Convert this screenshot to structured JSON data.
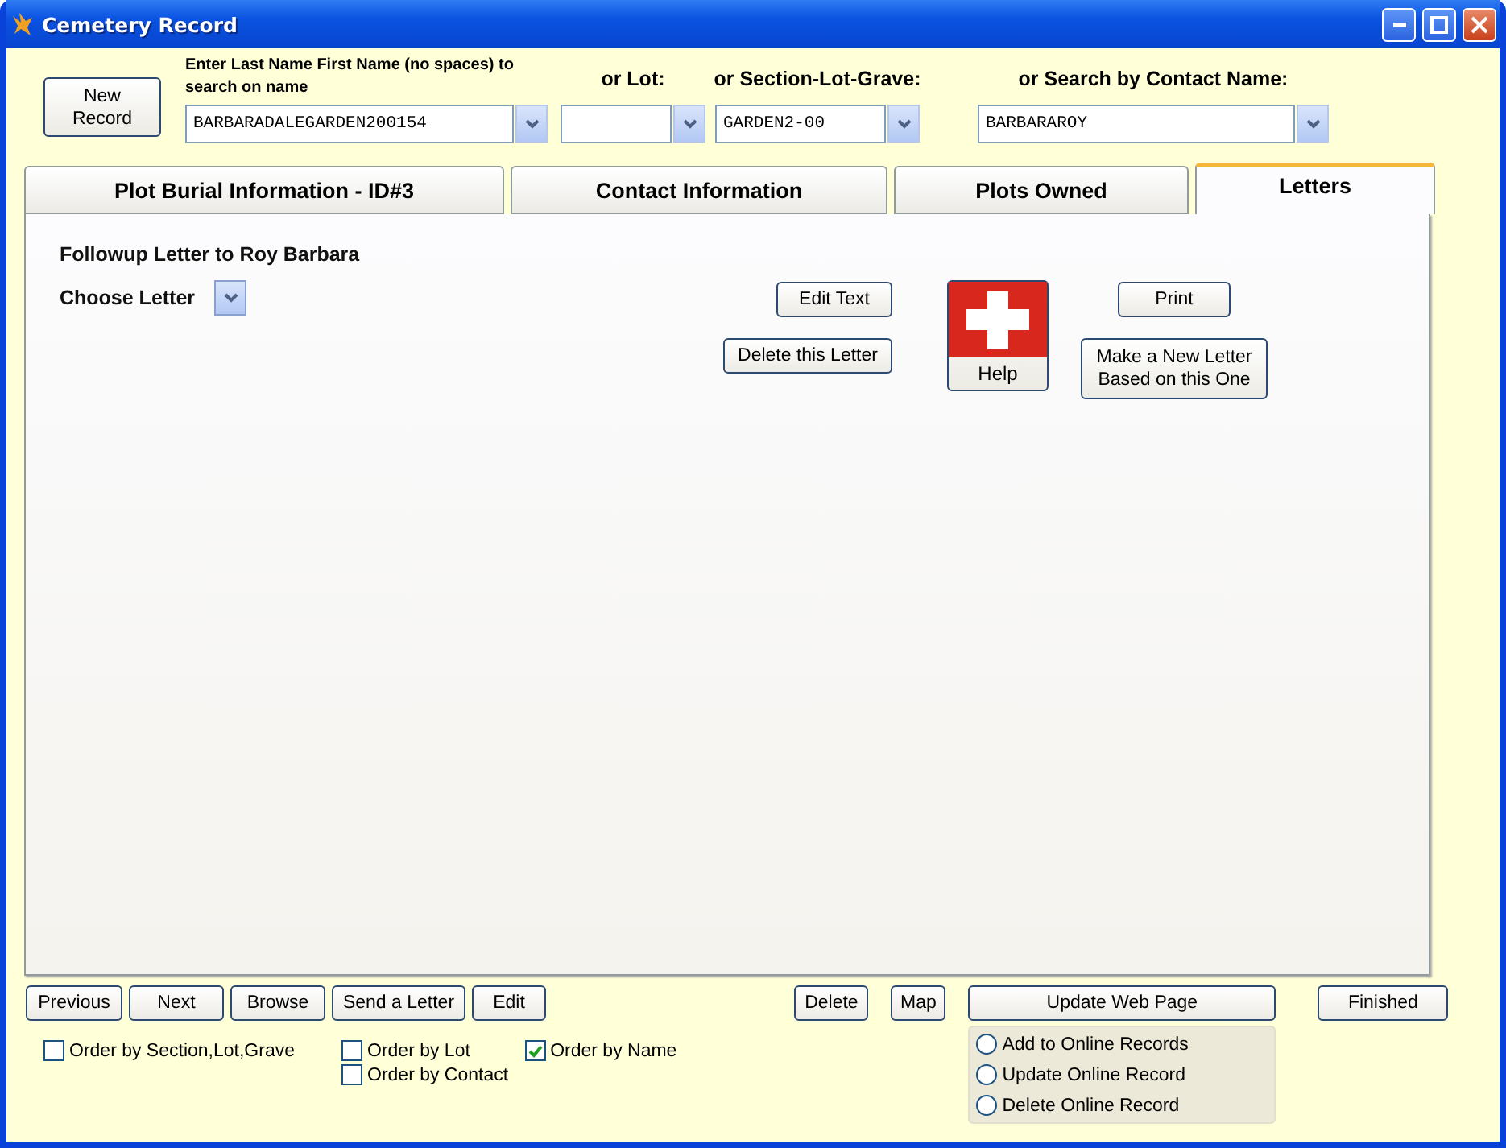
{
  "window": {
    "title": "Cemetery Record"
  },
  "new_record_button": "New\nRecord",
  "search_fields": [
    {
      "label": "Enter Last Name First Name (no spaces) to search on name",
      "value": "BARBARADALEGARDEN200154",
      "kind": "small"
    },
    {
      "label": "or Lot:",
      "kind": "large"
    },
    {
      "label": "or Section-Lot-Grave:",
      "value": "GARDEN2-00",
      "kind": "large"
    },
    {
      "label": "or Search by Contact Name:",
      "value": "BARBARAROY",
      "kind": "large"
    }
  ],
  "tabs": [
    {
      "label": "Plot Burial Information - ID#3",
      "selected": false
    },
    {
      "label": "Contact Information",
      "selected": false
    },
    {
      "label": "Plots Owned",
      "selected": false
    },
    {
      "label": "Letters",
      "selected": true
    }
  ],
  "letters": {
    "heading": "Followup Letter to Roy Barbara",
    "choose_label": "Choose Letter",
    "edit_text_button": "Edit Text",
    "delete_button": "Delete this Letter",
    "help_button": "Help",
    "print_button": "Print",
    "new_letter_button": "Make a New Letter\nBased on this One"
  },
  "nav_buttons": [
    "Previous",
    "Next",
    "Browse",
    "Send a Letter",
    "Edit"
  ],
  "delete_button": "Delete",
  "map_button": "Map",
  "update_web_button": "Update Web Page",
  "finished_button": "Finished",
  "order_options": [
    {
      "label": "Order by Section,Lot,Grave",
      "checked": false
    },
    {
      "label": "Order by Lot",
      "checked": false
    },
    {
      "label": "Order by Name",
      "checked": true
    },
    {
      "label": "Order by Contact",
      "checked": false
    }
  ],
  "online_actions": [
    {
      "label": "Add to Online Records",
      "selected": false
    },
    {
      "label": "Update Online Record",
      "selected": false
    },
    {
      "label": "Delete Online Record",
      "selected": false
    }
  ]
}
